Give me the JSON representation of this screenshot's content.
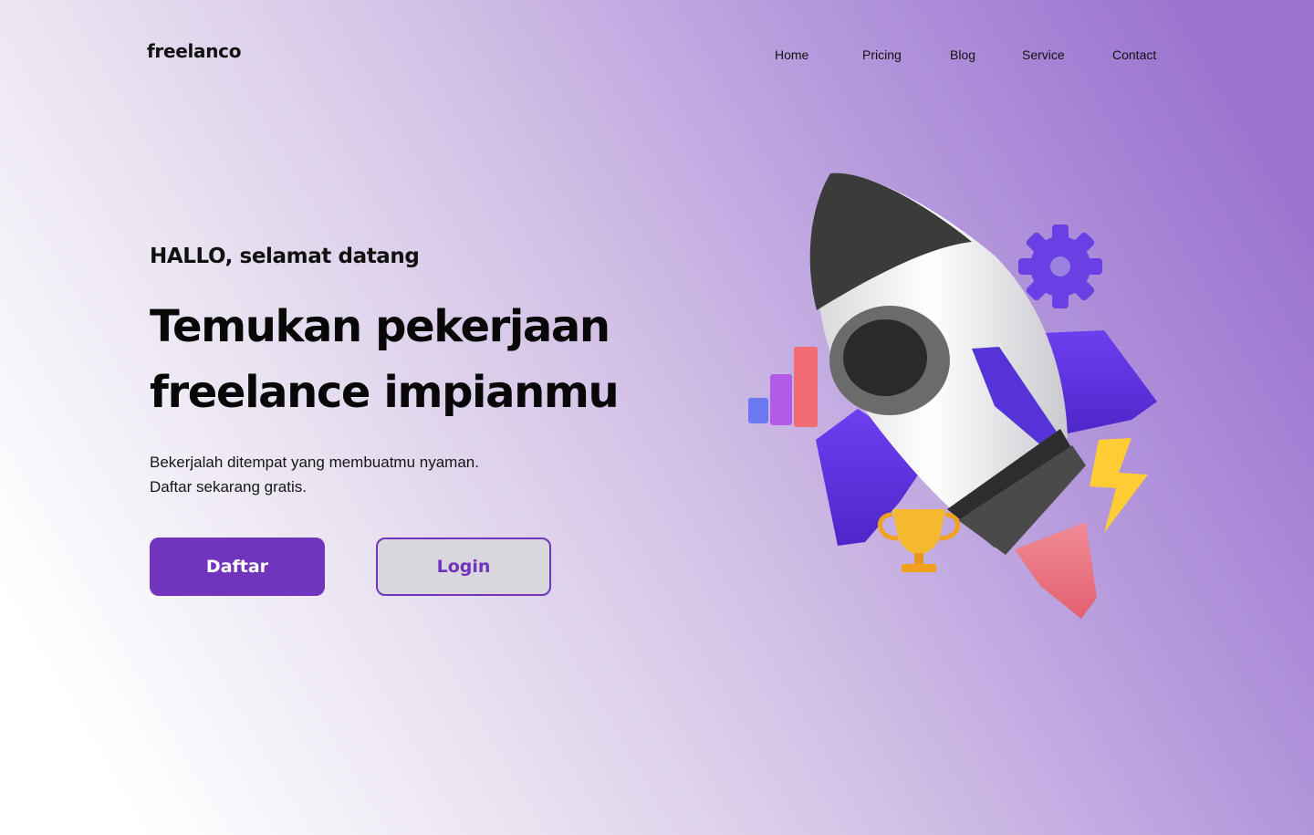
{
  "brand": {
    "name": "freelanco"
  },
  "nav": {
    "items": [
      {
        "label": "Home"
      },
      {
        "label": "Pricing"
      },
      {
        "label": "Blog"
      },
      {
        "label": "Service"
      },
      {
        "label": "Contact"
      }
    ]
  },
  "hero": {
    "eyebrow": "HALLO, selamat datang",
    "headline_line1": "Temukan pekerjaan",
    "headline_line2": "freelance impianmu",
    "subtext_line1": "Bekerjalah ditempat yang membuatmu nyaman.",
    "subtext_line2": "Daftar sekarang gratis.",
    "primary_button": "Daftar",
    "secondary_button": "Login"
  },
  "colors": {
    "accent": "#7034BD",
    "text": "#0D0D0D",
    "gradient_end": "#9C75D0"
  },
  "icons": [
    "rocket-illustration",
    "gear-icon",
    "bar-chart-icon",
    "lightning-icon",
    "trophy-icon"
  ]
}
